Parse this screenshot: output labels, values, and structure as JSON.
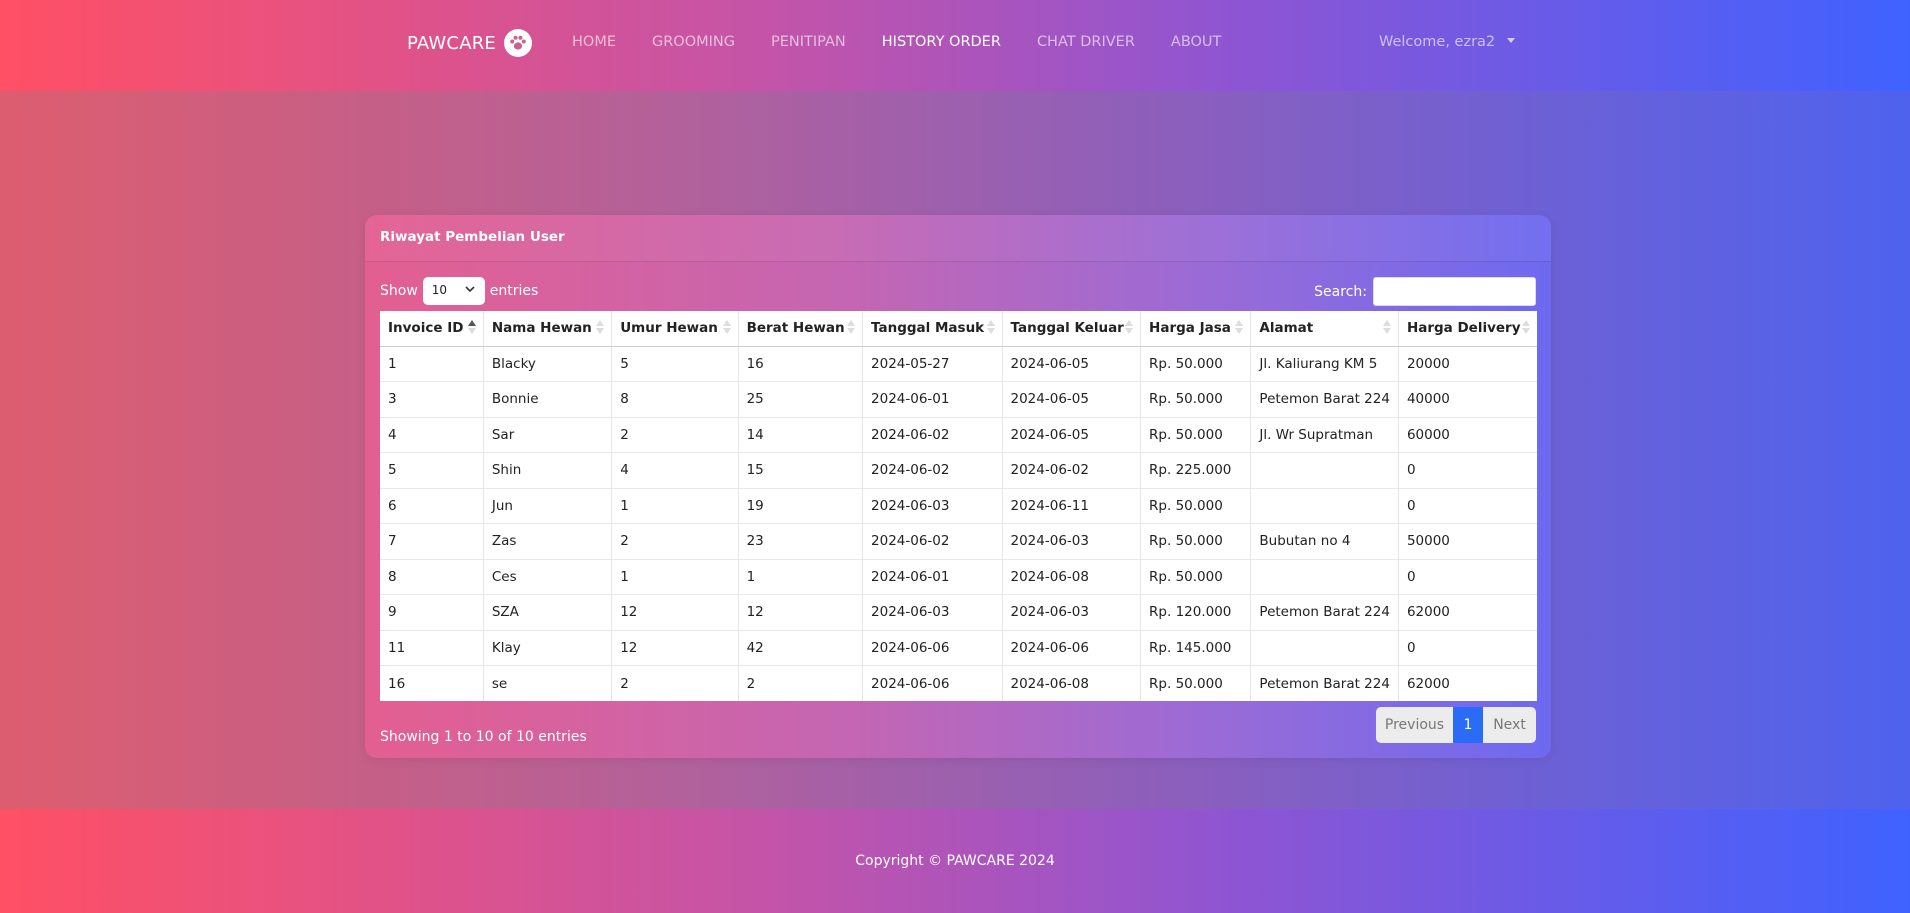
{
  "navbar": {
    "brand": "PAWCARE",
    "links": [
      "HOME",
      "GROOMING",
      "PENITIPAN",
      "HISTORY ORDER",
      "CHAT DRIVER",
      "ABOUT"
    ],
    "active": "HISTORY ORDER",
    "welcome": "Welcome, ezra2"
  },
  "card": {
    "title": "Riwayat Pembelian User",
    "show_label": "Show",
    "entries_value": "10",
    "entries_label": "entries",
    "search_label": "Search:",
    "search_value": ""
  },
  "table": {
    "headers": [
      "Invoice ID",
      "Nama Hewan",
      "Umur Hewan",
      "Berat Hewan",
      "Tanggal Masuk",
      "Tanggal Keluar",
      "Harga Jasa",
      "Alamat",
      "Harga Delivery"
    ],
    "rows": [
      [
        "1",
        "Blacky",
        "5",
        "16",
        "2024-05-27",
        "2024-06-05",
        "Rp. 50.000",
        "Jl. Kaliurang KM 5",
        "20000"
      ],
      [
        "3",
        "Bonnie",
        "8",
        "25",
        "2024-06-01",
        "2024-06-05",
        "Rp. 50.000",
        "Petemon Barat 224",
        "40000"
      ],
      [
        "4",
        "Sar",
        "2",
        "14",
        "2024-06-02",
        "2024-06-05",
        "Rp. 50.000",
        "Jl. Wr Supratman",
        "60000"
      ],
      [
        "5",
        "Shin",
        "4",
        "15",
        "2024-06-02",
        "2024-06-02",
        "Rp. 225.000",
        "",
        "0"
      ],
      [
        "6",
        "Jun",
        "1",
        "19",
        "2024-06-03",
        "2024-06-11",
        "Rp. 50.000",
        "",
        "0"
      ],
      [
        "7",
        "Zas",
        "2",
        "23",
        "2024-06-02",
        "2024-06-03",
        "Rp. 50.000",
        "Bubutan no 4",
        "50000"
      ],
      [
        "8",
        "Ces",
        "1",
        "1",
        "2024-06-01",
        "2024-06-08",
        "Rp. 50.000",
        "",
        "0"
      ],
      [
        "9",
        "SZA",
        "12",
        "12",
        "2024-06-03",
        "2024-06-03",
        "Rp. 120.000",
        "Petemon Barat 224",
        "62000"
      ],
      [
        "11",
        "Klay",
        "12",
        "42",
        "2024-06-06",
        "2024-06-06",
        "Rp. 145.000",
        "",
        "0"
      ],
      [
        "16",
        "se",
        "2",
        "2",
        "2024-06-06",
        "2024-06-08",
        "Rp. 50.000",
        "Petemon Barat 224",
        "62000"
      ]
    ]
  },
  "pagination": {
    "info": "Showing 1 to 10 of 10 entries",
    "previous": "Previous",
    "current": "1",
    "next": "Next"
  },
  "footer": {
    "text": "Copyright © PAWCARE 2024"
  }
}
